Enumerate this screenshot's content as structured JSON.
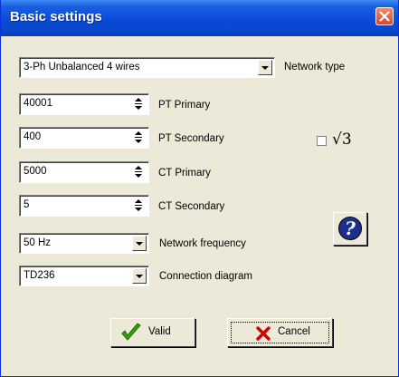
{
  "window": {
    "title": "Basic settings"
  },
  "network_type": {
    "value": "3-Ph Unbalanced 4 wires",
    "label": "Network type"
  },
  "pt_primary": {
    "value": "40001",
    "label": "PT Primary"
  },
  "pt_secondary": {
    "value": "400",
    "label": "PT Secondary"
  },
  "ct_primary": {
    "value": "5000",
    "label": "CT Primary"
  },
  "ct_secondary": {
    "value": "5",
    "label": "CT Secondary"
  },
  "network_frequency": {
    "value": "50 Hz",
    "label": "Network frequency"
  },
  "connection_diagram": {
    "value": "TD236",
    "label": "Connection diagram"
  },
  "sqrt3": {
    "checked": false,
    "label": "√3"
  },
  "buttons": {
    "valid": "Valid",
    "cancel": "Cancel"
  },
  "icons": {
    "close": "close-icon",
    "help": "help-icon",
    "valid": "checkmark-icon",
    "cancel": "red-x-icon"
  },
  "colors": {
    "title_bar": "#0a4ad8",
    "dialog_bg": "#ece9d8",
    "close_red": "#d8482a",
    "check_green": "#3aa010",
    "cancel_red": "#d00000"
  }
}
